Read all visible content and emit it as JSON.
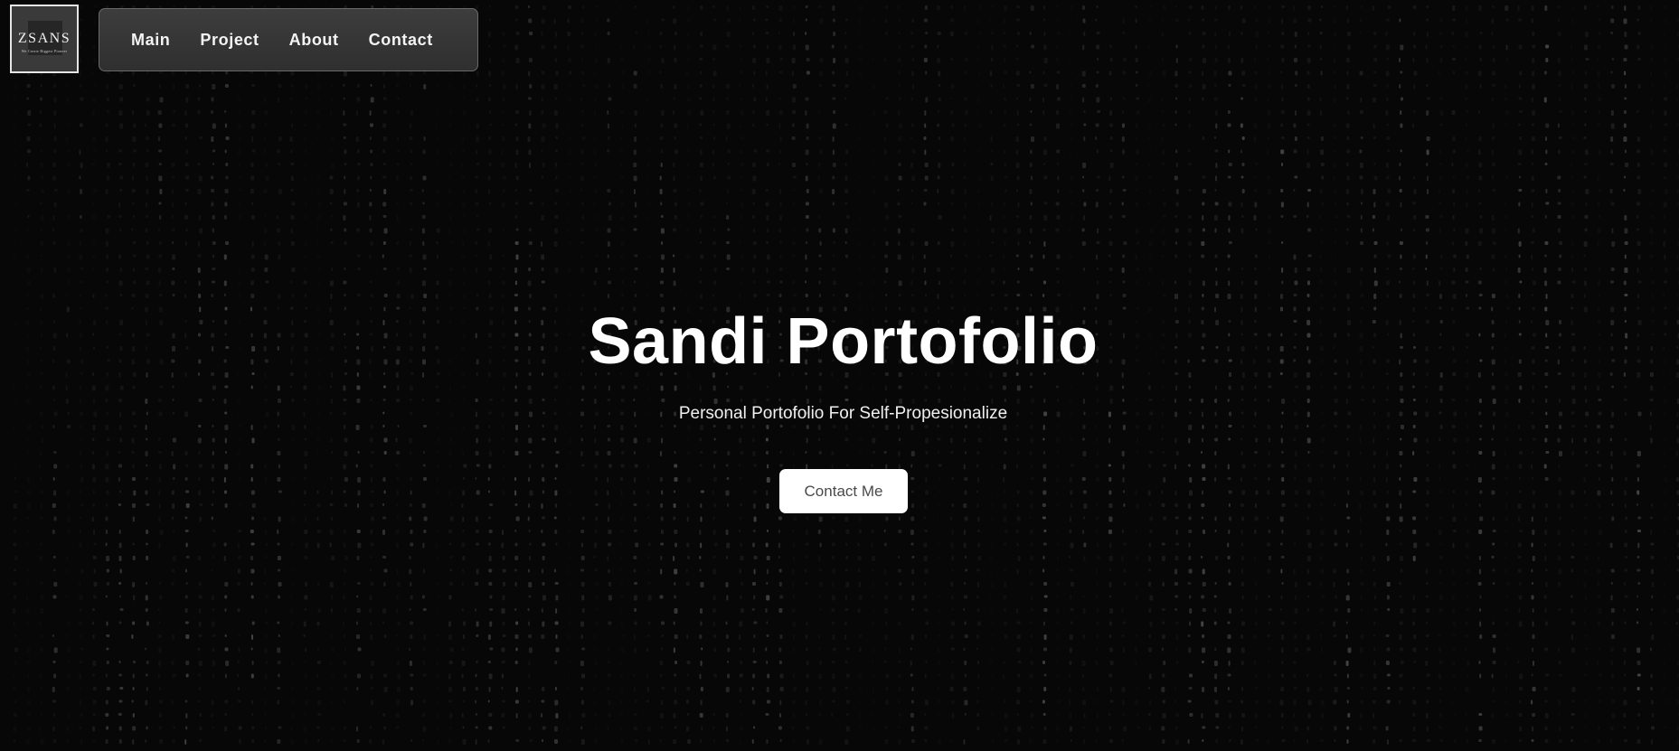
{
  "logo": {
    "title": "ZSANS",
    "tagline": "We Create Biggest Pioneer"
  },
  "nav": {
    "items": [
      {
        "label": "Main"
      },
      {
        "label": "Project"
      },
      {
        "label": "About"
      },
      {
        "label": "Contact"
      }
    ]
  },
  "hero": {
    "title": "Sandi Portofolio",
    "subtitle": "Personal Portofolio For Self-Propesionalize",
    "cta_label": "Contact Me"
  },
  "colors": {
    "background": "#070707",
    "nav_background": "#363636",
    "text": "#ffffff",
    "button_background": "#ffffff",
    "button_text": "#4a4a4a",
    "matrix_glyph": "#9a9a9a"
  }
}
